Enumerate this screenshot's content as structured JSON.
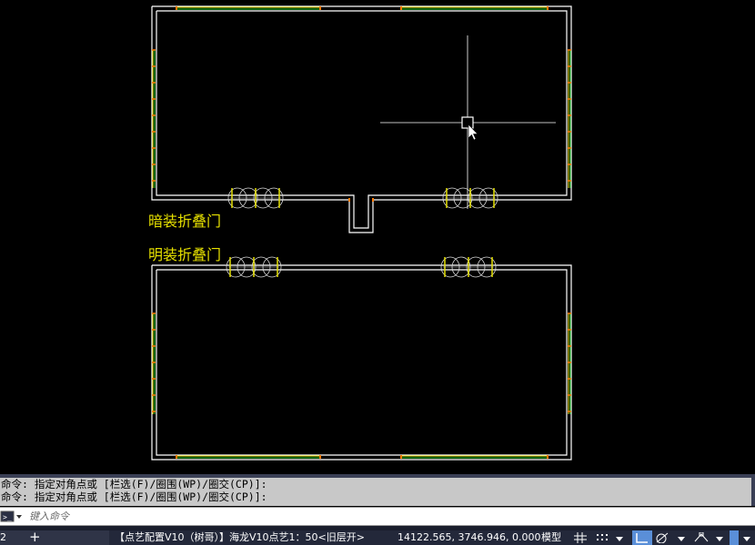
{
  "drawing": {
    "labels": {
      "hidden_folding_door": "暗装折叠门",
      "exposed_folding_door": "明装折叠门"
    },
    "colors": {
      "wall": "#ffffff",
      "window_line": "#e6e000",
      "window_accent": "#22cc22",
      "mark": "#ff7a00",
      "door": "#d8d8d8",
      "crosshair": "#ffffff"
    }
  },
  "command": {
    "history": [
      "命令: 指定对角点或 [栏选(F)/圈围(WP)/圈交(CP)]:",
      "命令: 指定对角点或 [栏选(F)/圈围(WP)/圈交(CP)]:"
    ],
    "input_placeholder": "键入命令",
    "prompt_icon": "command-prompt-icon"
  },
  "statusbar": {
    "tab_number": "2",
    "add_tab_icon": "plus-icon",
    "document_info": "【点艺配置V10（树哥）】海龙V10点艺1：50<旧层开>",
    "coordinates": "14122.565, 3746.946, 0.000",
    "model_label": "模型",
    "icons": [
      "grid-icon",
      "snap-grid-icon",
      "dropdown-icon",
      "ortho-icon",
      "polar-icon",
      "dropdown-icon",
      "osnap-icon"
    ]
  }
}
